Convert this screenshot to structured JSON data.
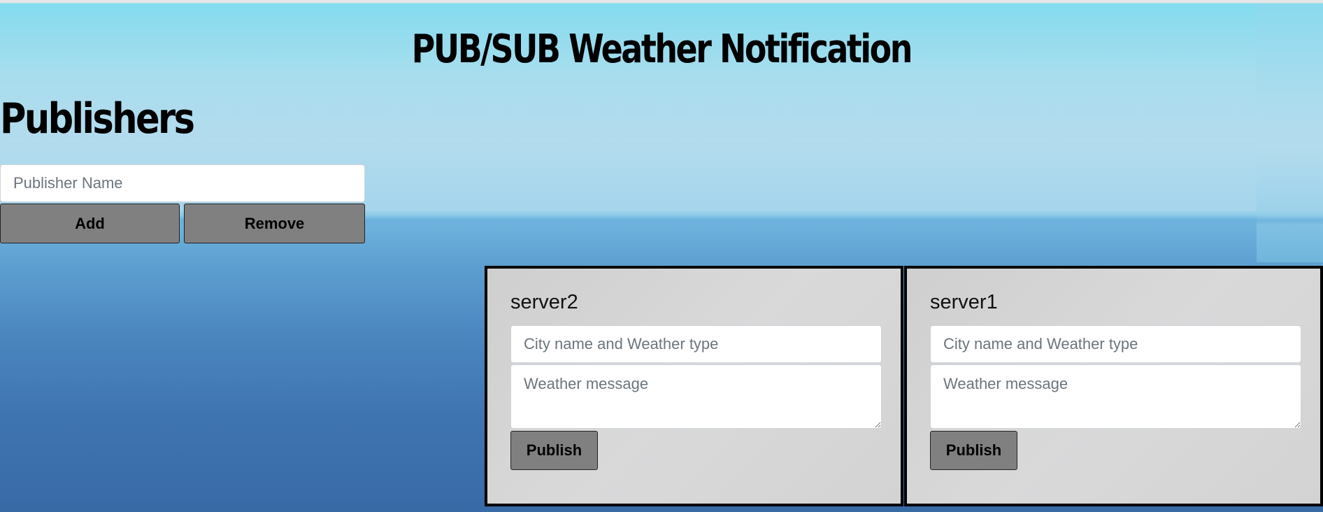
{
  "page": {
    "title": "PUB/SUB Weather Notification"
  },
  "publishers": {
    "heading": "Publishers",
    "name_input": {
      "placeholder": "Publisher Name",
      "value": ""
    },
    "add_label": "Add",
    "remove_label": "Remove"
  },
  "servers": [
    {
      "name": "server2",
      "city_placeholder": "City name and Weather type",
      "city_value": "",
      "message_placeholder": "Weather message",
      "message_value": "",
      "publish_label": "Publish"
    },
    {
      "name": "server1",
      "city_placeholder": "City name and Weather type",
      "city_value": "",
      "message_placeholder": "Weather message",
      "message_value": "",
      "publish_label": "Publish"
    }
  ],
  "colors": {
    "button_bg": "#808080",
    "card_bg": "#d6d6d6",
    "card_border": "#000000",
    "sky": "#84dcef",
    "sea": "#3e74b0"
  }
}
